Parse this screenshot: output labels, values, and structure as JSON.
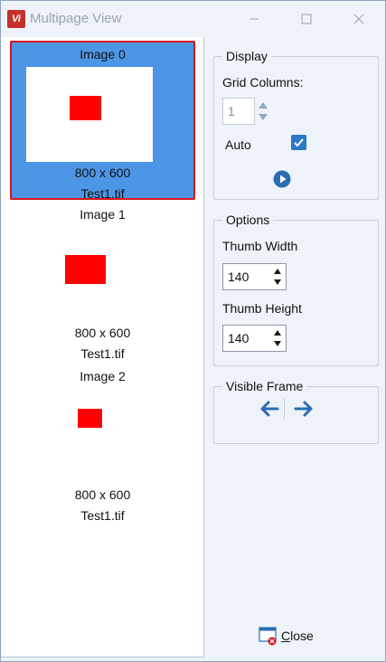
{
  "window": {
    "title": "Multipage View",
    "app_icon_text": "Vi"
  },
  "thumbnails": [
    {
      "title": "Image 0",
      "size": "800 x 600",
      "file": "Test1.tif",
      "selected": true
    },
    {
      "title": "Image 1",
      "size": "800 x 600",
      "file": "Test1.tif",
      "selected": false
    },
    {
      "title": "Image 2",
      "size": "800 x 600",
      "file": "Test1.tif",
      "selected": false
    }
  ],
  "display": {
    "legend": "Display",
    "grid_columns_label": "Grid Columns:",
    "grid_columns_value": "1",
    "auto_label": "Auto",
    "auto_checked": true
  },
  "options": {
    "legend": "Options",
    "thumb_width_label": "Thumb Width",
    "thumb_width_value": "140",
    "thumb_height_label": "Thumb Height",
    "thumb_height_value": "140"
  },
  "visible_frame": {
    "legend": "Visible Frame"
  },
  "footer": {
    "close_label": "Close"
  },
  "colors": {
    "selection": "#4d96e6",
    "selection_border": "#d9141b",
    "accent": "#2b79c7",
    "image_rect": "#ff0000"
  }
}
